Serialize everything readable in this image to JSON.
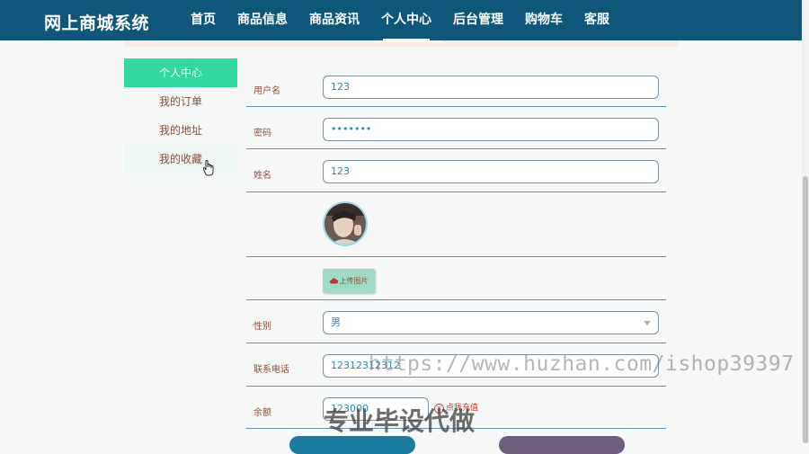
{
  "header": {
    "brand": "网上商城系统",
    "nav": [
      "首页",
      "商品信息",
      "商品资讯",
      "个人中心",
      "后台管理",
      "购物车",
      "客服"
    ],
    "active_nav": "个人中心"
  },
  "sidebar": {
    "items": [
      {
        "label": "个人中心"
      },
      {
        "label": "我的订单"
      },
      {
        "label": "我的地址"
      },
      {
        "label": "我的收藏"
      }
    ]
  },
  "form": {
    "username": {
      "label": "用户名",
      "value": "123"
    },
    "password": {
      "label": "密码",
      "value": "•••••••"
    },
    "name": {
      "label": "姓名",
      "value": "123"
    },
    "upload_label": "上传图片",
    "gender": {
      "label": "性别",
      "value": "男"
    },
    "phone": {
      "label": "联系电话",
      "value": "12312312312"
    },
    "balance": {
      "label": "余额",
      "value": "123000"
    },
    "recharge_label": "点我充值"
  },
  "overlays": {
    "watermark_url": "https://www.huzhan.com/ishop39397",
    "watermark_cn": "专业毕设代做"
  },
  "colors": {
    "header_bg": "#0f577a",
    "sidebar_active": "#33d7a1",
    "label_text": "#8b4e3a",
    "input_text": "#1f8aba",
    "upload_btn": "#9fdcc5"
  }
}
